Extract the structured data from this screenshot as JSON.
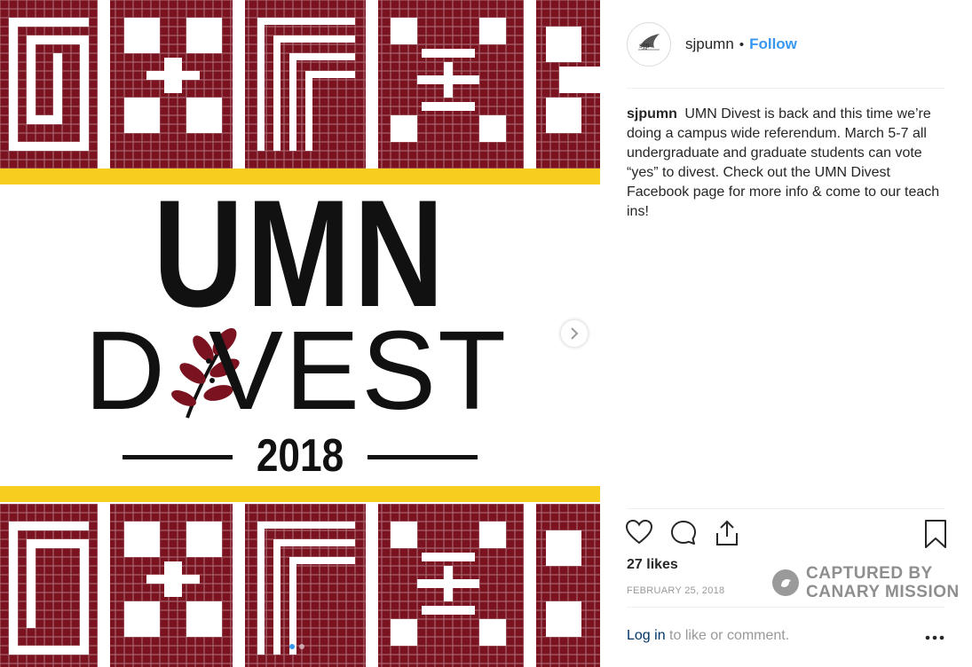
{
  "post": {
    "image": {
      "headline": "UMN",
      "divest_first": "D",
      "divest_rest": "VEST",
      "year": "2018",
      "palette": {
        "maroon": "#7a1220",
        "gold": "#f7cd1e",
        "ink": "#111111"
      },
      "next_icon": "chevron-right-icon",
      "carousel": {
        "count": 2,
        "active": 1
      }
    },
    "author": {
      "username": "sjpumn",
      "separator": "•",
      "follow_label": "Follow",
      "avatar_text": "sjp"
    },
    "caption": {
      "username": "sjpumn",
      "text": "UMN Divest is back and this time we’re doing a campus wide referendum. March 5-7 all undergraduate and graduate students can vote “yes” to divest. Check out the UMN Divest Facebook page for more info & come to our teach ins!"
    },
    "actions": {
      "icons": [
        "heart-icon",
        "comment-icon",
        "share-icon",
        "bookmark-icon"
      ]
    },
    "likes_label": "27 likes",
    "date": "FEBRUARY 25, 2018",
    "watermark": {
      "line1": "CAPTURED BY",
      "line2": "CANARY MISSION"
    },
    "login": {
      "link": "Log in",
      "rest": " to like or comment."
    },
    "more_icon": "more-options-icon",
    "accent_color": "#3897f0"
  }
}
